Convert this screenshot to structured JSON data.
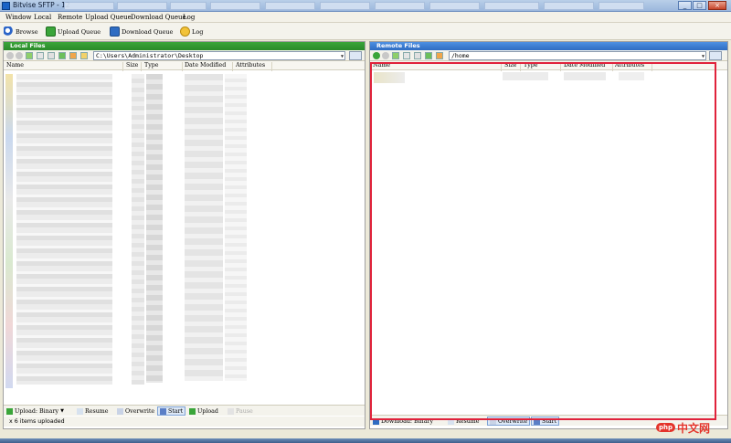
{
  "window": {
    "title": "Bitvise SFTP - 12"
  },
  "menu": [
    "Window",
    "Local",
    "Remote",
    "Upload Queue",
    "Download Queue",
    "Log"
  ],
  "toolbar": {
    "browse": "Browse",
    "upload_queue": "Upload Queue",
    "download_queue": "Download Queue",
    "log": "Log"
  },
  "local": {
    "header": "Local Files",
    "path": "C:\\Users\\Administrator\\Desktop",
    "columns": {
      "name": "Name",
      "size": "Size",
      "type": "Type",
      "date": "Date Modified",
      "attr": "Attributes"
    },
    "bottom": {
      "upload_mode": "Upload: Binary",
      "resume": "Resume",
      "overwrite": "Overwrite",
      "start": "Start",
      "upload": "Upload",
      "pause": "Pause"
    },
    "status": "x 6 items uploaded"
  },
  "remote": {
    "header": "Remote Files",
    "path": "/home",
    "columns": {
      "name": "Name",
      "size": "Size",
      "type": "Type",
      "date": "Date Modified",
      "attr": "Attributes"
    },
    "bottom": {
      "download_mode": "Download: Binary",
      "resume": "Resume",
      "overwrite": "Overwrite",
      "start": "Start"
    }
  },
  "watermark": {
    "php": "php",
    "cn": "中文网"
  },
  "colors": {
    "local_header": "#2f962f",
    "remote_header": "#3a7bd5",
    "highlight_box": "#e0223b"
  }
}
